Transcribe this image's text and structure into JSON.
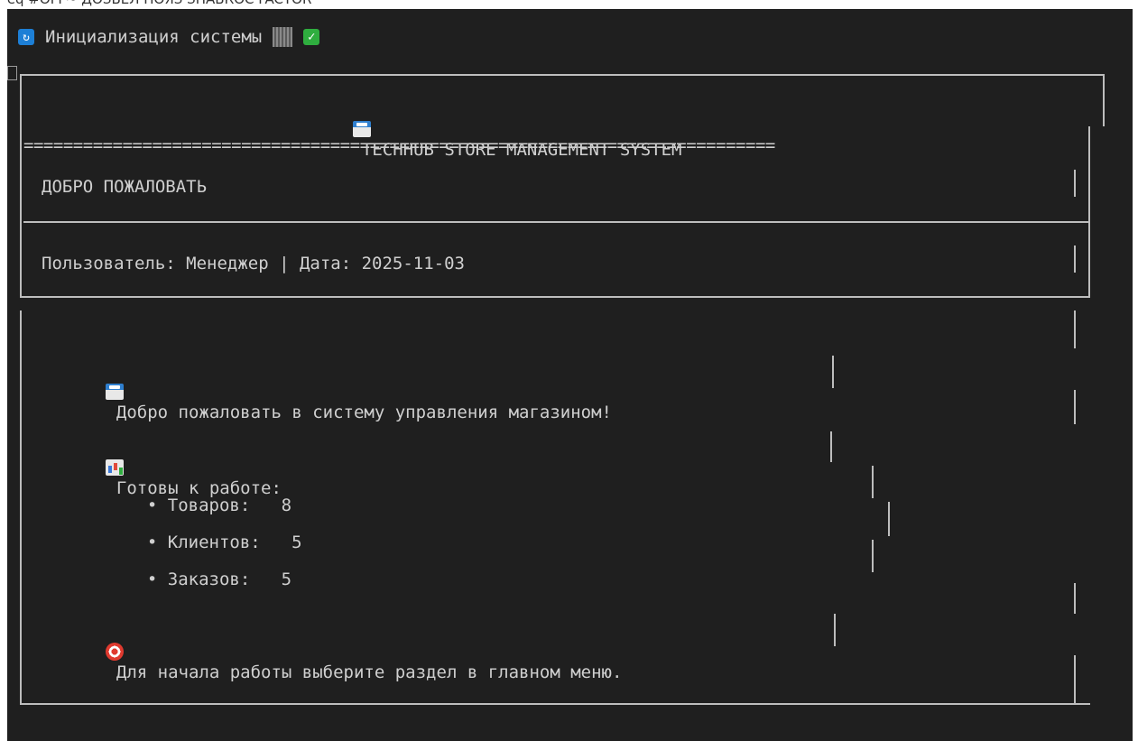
{
  "header": {
    "cut_text": "seq #OFF~ ДОЗВЕЛ НОЯЗ ЗНАВКОС FACTOR",
    "init_text": "Инициализация системы",
    "status_icon": "check-icon"
  },
  "banner": {
    "title": "TECHHUB STORE MANAGEMENT SYSTEM",
    "separator": "============================================================================",
    "welcome_heading": "ДОБРО ПОЖАЛОВАТЬ",
    "user_line": "Пользователь: Менеджер | Дата: 2025-11-03"
  },
  "body": {
    "greeting": "Добро пожаловать в систему управления магазином!",
    "ready_label": "Готовы к работе:",
    "stats": [
      {
        "label": "• Товаров:",
        "value": "8"
      },
      {
        "label": "• Клиентов:",
        "value": "5"
      },
      {
        "label": "• Заказов:",
        "value": "5"
      }
    ],
    "hint": "Для начала работы выберите раздел в главном меню."
  },
  "colors": {
    "background": "#1f1f1f",
    "text": "#cfcfcf",
    "frame": "#bdbdbd",
    "accent_blue": "#1d7fd6",
    "accent_green": "#2fae3f"
  }
}
